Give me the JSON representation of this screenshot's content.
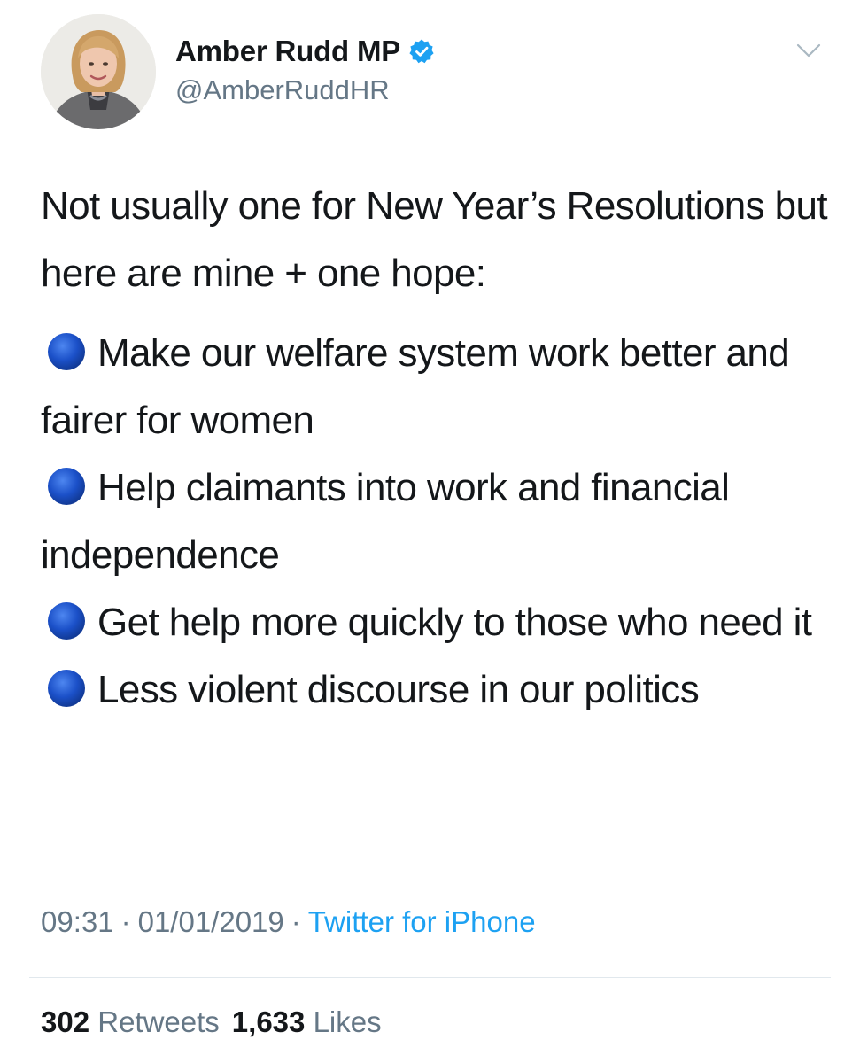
{
  "author": {
    "display_name": "Amber Rudd MP",
    "handle": "@AmberRuddHR",
    "verified": true,
    "avatar_icon": "profile-photo"
  },
  "menu_icon": "chevron-down-icon",
  "tweet": {
    "intro": "Not usually one for New Year’s Resolutions but here are mine + one hope:",
    "bullet_icon": "blue-circle-emoji",
    "bullets": [
      "Make our welfare system work better and fairer for women",
      "Help claimants into work and financial independence",
      "Get help more quickly to those who need it",
      "Less violent discourse in our politics"
    ]
  },
  "meta": {
    "time": "09:31",
    "date": "01/01/2019",
    "separator": "·",
    "source": "Twitter for iPhone"
  },
  "stats": {
    "retweets_count": "302",
    "retweets_label": "Retweets",
    "likes_count": "1,633",
    "likes_label": "Likes"
  },
  "colors": {
    "text": "#14171a",
    "secondary": "#657786",
    "link": "#1da1f2",
    "verified": "#1da1f2",
    "bullet": "#1b50c8",
    "divider": "#e1e8ed"
  }
}
